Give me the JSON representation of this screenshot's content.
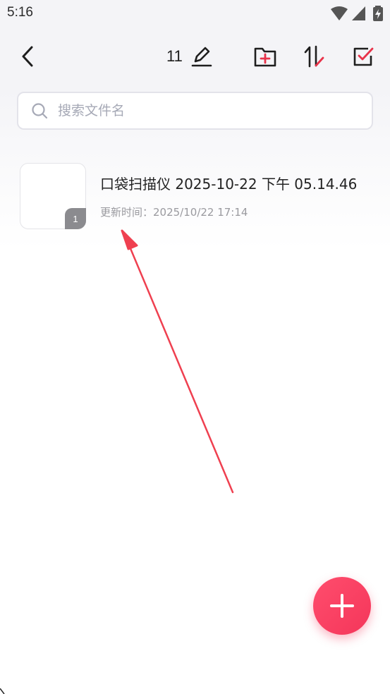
{
  "status_bar": {
    "time": "5:16",
    "icons": [
      "wifi-icon",
      "signal-icon",
      "battery-charging-icon"
    ]
  },
  "toolbar": {
    "back_icon": "chevron-left-icon",
    "rename_count": "11",
    "rename_icon": "pencil-icon",
    "new_folder_icon": "folder-plus-icon",
    "sort_icon": "sort-arrows-icon",
    "select_icon": "checkbox-icon",
    "accent_color": "#e8334a"
  },
  "search": {
    "placeholder": "搜索文件名",
    "value": ""
  },
  "files": [
    {
      "title": "口袋扫描仪 2025-10-22 下午 05.14.46",
      "updated": "更新时间：2025/10/22 17:14",
      "page_count": "1"
    }
  ],
  "fab": {
    "icon": "plus-icon",
    "color": "#f4365a"
  },
  "annotation": {
    "type": "arrow",
    "color": "#ef4050"
  }
}
